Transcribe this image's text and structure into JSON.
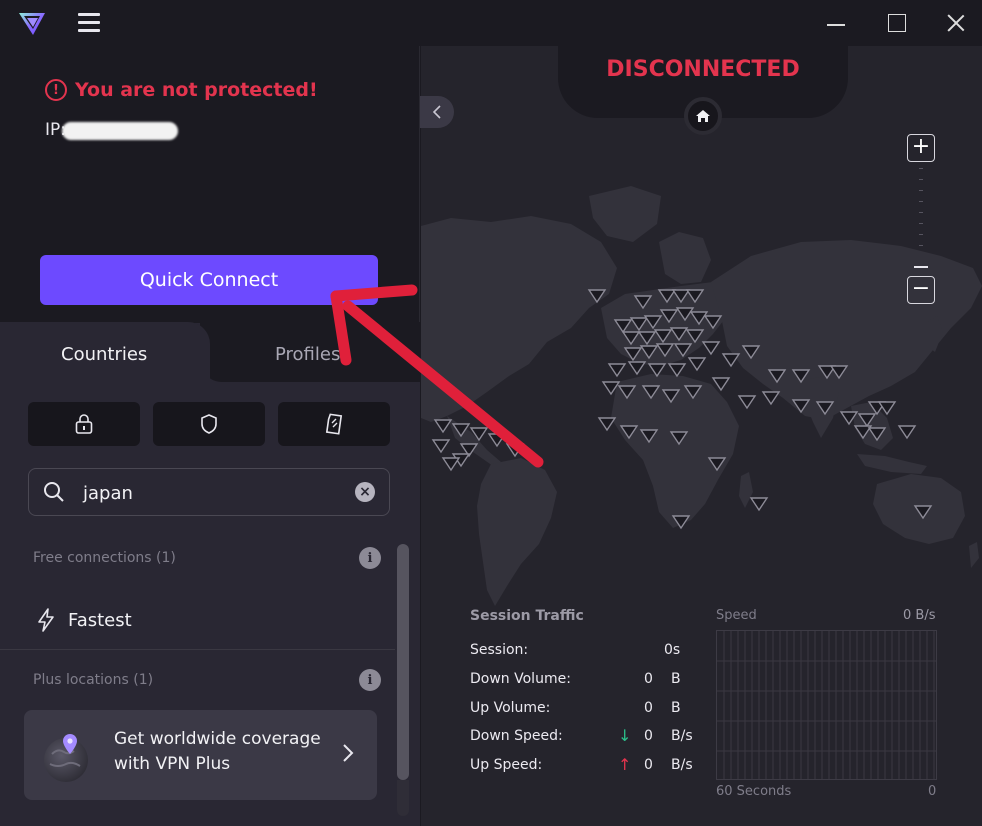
{
  "app": {
    "title": "Proton VPN",
    "colors": {
      "accent": "#6d4aff",
      "danger": "#e3344e",
      "down_arrow": "#2bbf8a",
      "up_arrow": "#e3344e"
    }
  },
  "titlebar": {
    "menu_icon": "hamburger-icon",
    "window_controls": [
      "minimize",
      "maximize",
      "close"
    ]
  },
  "status_panel": {
    "warning": "You are not protected!",
    "ip_label": "IP:",
    "quick_connect": "Quick Connect"
  },
  "tabs": [
    {
      "label": "Countries",
      "active": true
    },
    {
      "label": "Profiles",
      "active": false
    }
  ],
  "filters": [
    {
      "icon": "lock-icon"
    },
    {
      "icon": "shield-icon"
    },
    {
      "icon": "sd-card-icon"
    }
  ],
  "search": {
    "value": "japan"
  },
  "list": {
    "free_header": "Free connections (1)",
    "fastest": "Fastest",
    "plus_header": "Plus locations (1)",
    "upsell": "Get worldwide coverage with VPN Plus"
  },
  "map": {
    "status": "DISCONNECTED",
    "zoom_in": "+",
    "zoom_out": "−"
  },
  "traffic": {
    "title": "Session Traffic",
    "rows": [
      {
        "label": "Session:",
        "value": "0s",
        "unit": ""
      },
      {
        "label": "Down Volume:",
        "value": "0",
        "unit": "B"
      },
      {
        "label": "Up Volume:",
        "value": "0",
        "unit": "B"
      },
      {
        "label": "Down Speed:",
        "value": "0",
        "unit": "B/s",
        "arrow": "↓"
      },
      {
        "label": "Up Speed:",
        "value": "0",
        "unit": "B/s",
        "arrow": "↑"
      }
    ],
    "speed": {
      "label": "Speed",
      "value": "0  B/s",
      "left_foot": "60 Seconds",
      "right_foot": "0"
    }
  }
}
